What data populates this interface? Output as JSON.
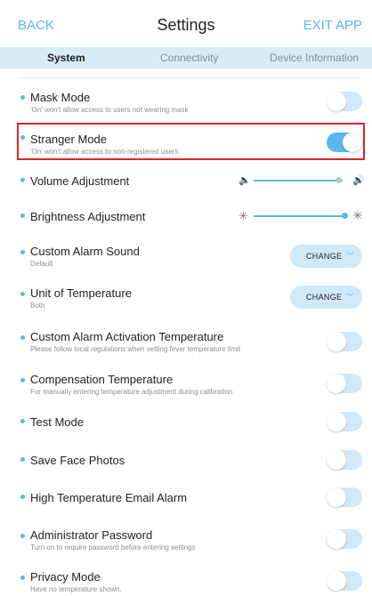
{
  "header": {
    "back": "BACK",
    "title": "Settings",
    "exit": "EXIT APP"
  },
  "tabs": [
    {
      "label": "System",
      "active": true
    },
    {
      "label": "Connectivity",
      "active": false
    },
    {
      "label": "Device Information",
      "active": false
    }
  ],
  "settings": {
    "mask_mode": {
      "title": "Mask Mode",
      "sub": "'On' won't allow access to users not wearing mask",
      "on": false
    },
    "stranger_mode": {
      "title": "Stranger Mode",
      "sub": "'On' won't allow access to non-registered users",
      "on": true,
      "highlighted": true
    },
    "volume": {
      "title": "Volume Adjustment",
      "level": 0.95,
      "icon_low": "volume-low-icon",
      "icon_high": "volume-high-icon"
    },
    "brightness": {
      "title": "Brightness Adjustment",
      "level": 0.98,
      "icon_low": "brightness-low-icon",
      "icon_high": "brightness-high-icon"
    },
    "alarm_sound": {
      "title": "Custom Alarm Sound",
      "sub": "Default",
      "button": "CHANGE"
    },
    "temp_unit": {
      "title": "Unit of Temperature",
      "sub": "Both",
      "button": "CHANGE"
    },
    "alarm_temp": {
      "title": "Custom Alarm Activation Temperature",
      "sub": "Please follow local regulations when setting fever temperature limit",
      "on": false
    },
    "compensation": {
      "title": "Compensation Temperature",
      "sub": "For manually entering temperature adjustment during calibration",
      "on": false
    },
    "test_mode": {
      "title": "Test Mode",
      "on": false
    },
    "save_face": {
      "title": "Save Face Photos",
      "on": false
    },
    "high_temp_email": {
      "title": "High Temperature Email Alarm",
      "on": false
    },
    "admin_password": {
      "title": "Administrator Password",
      "sub": "Turn on to require password before entering settings",
      "on": false
    },
    "privacy_mode": {
      "title": "Privacy Mode",
      "sub": "Have no temperature shown.",
      "on": false
    }
  },
  "colors": {
    "accent": "#5ab8ea",
    "tab_bar": "#d6ecf9",
    "toggle_off": "#cfe9f9",
    "highlight": "#e02424"
  }
}
